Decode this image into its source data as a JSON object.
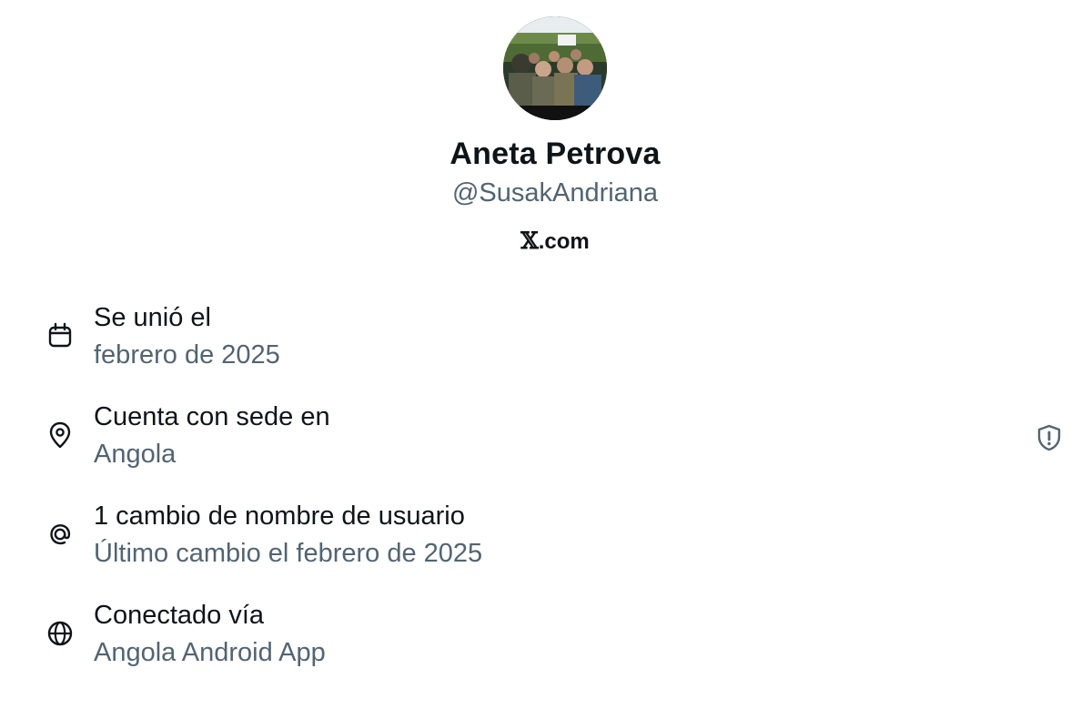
{
  "profile": {
    "display_name": "Aneta Petrova",
    "handle": "@SusakAndriana",
    "domain_prefix": "𝕏",
    "domain_suffix": ".com",
    "avatar": "group-photo"
  },
  "about": [
    {
      "icon": "calendar-icon",
      "title": "Se unió el",
      "value": "febrero de 2025"
    },
    {
      "icon": "location-pin-icon",
      "title": "Cuenta con sede en",
      "value": "Angola"
    },
    {
      "icon": "at-sign-icon",
      "title": "1 cambio de nombre de usuario",
      "value": "Último cambio el febrero de 2025"
    },
    {
      "icon": "globe-icon",
      "title": "Conectado vía",
      "value": "Angola Android App"
    }
  ],
  "colors": {
    "primary_text": "#0f1419",
    "secondary_text": "#536471"
  },
  "shield_icon": "shield-alert-icon"
}
